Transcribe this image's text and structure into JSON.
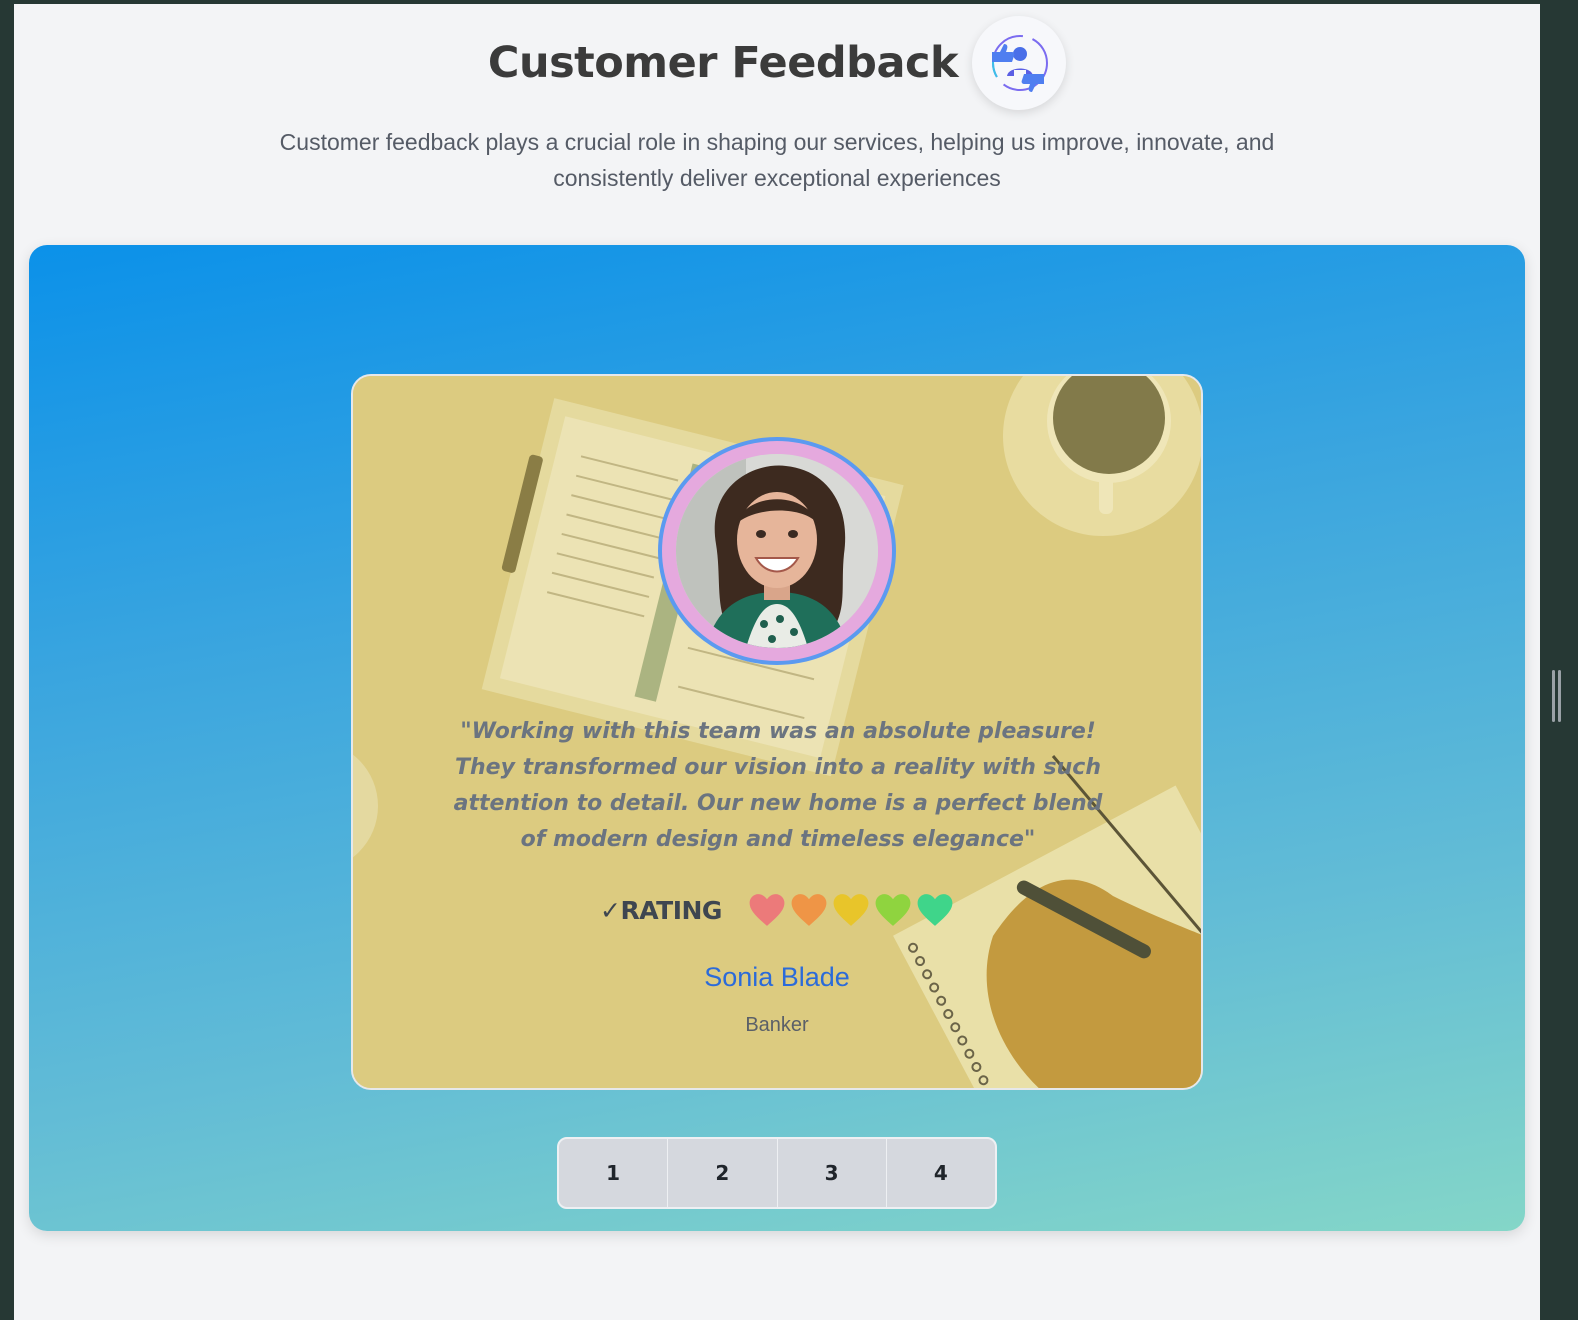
{
  "header": {
    "title": "Customer Feedback",
    "subtitle": "Customer feedback plays a crucial role in shaping our services, helping us improve, innovate, and consistently deliver exceptional experiences",
    "logo_icon": "feedback-thumbs-icon"
  },
  "testimonial": {
    "quote": "\"Working with this team was an absolute pleasure! They transformed our vision into a reality with such attention to detail. Our new home is a perfect blend of modern design and timeless elegance\"",
    "rating_label": "✓RATING",
    "rating_hearts": 5,
    "heart_colors": [
      "#ec7a7a",
      "#ef9546",
      "#e8c52a",
      "#8fd43f",
      "#3fd58a"
    ],
    "name": "Sonia Blade",
    "role": "Banker"
  },
  "pager": {
    "pages": [
      "1",
      "2",
      "3",
      "4"
    ]
  },
  "colors": {
    "accent_name": "#2b6bd9",
    "hero_gradient_start": "#0b91e9",
    "hero_gradient_end": "#84d6c8"
  }
}
